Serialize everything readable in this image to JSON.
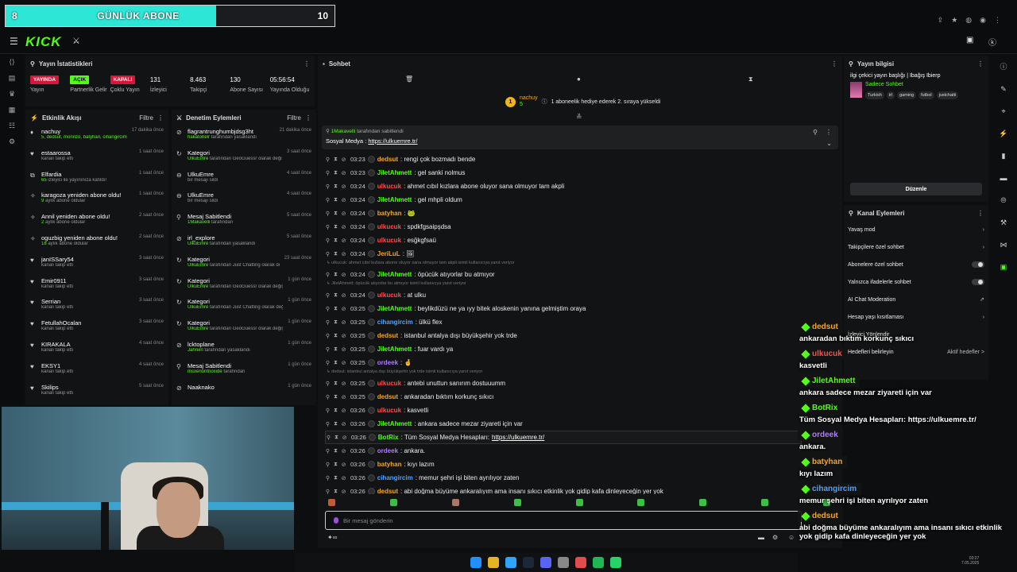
{
  "sub_goal": {
    "left": "8",
    "title": "GÜNLÜK ABONE",
    "right": "10",
    "progress": 0.8
  },
  "header": {
    "logo": "KICK",
    "logo_sup": "beta"
  },
  "stats": {
    "title": "Yayın İstatistikleri",
    "items": [
      {
        "value": "YAYINDA",
        "label": "Yayın",
        "badge": "red"
      },
      {
        "value": "AÇIK",
        "label": "Partnerlik Gelir",
        "badge": "green"
      },
      {
        "value": "KAPALI",
        "label": "Çoklu Yayın",
        "badge": "red"
      },
      {
        "value": "131",
        "label": "İzleyici"
      },
      {
        "value": "8.463",
        "label": "Takipçi"
      },
      {
        "value": "130",
        "label": "Abone Sayısı"
      },
      {
        "value": "05:56:54",
        "label": "Yayında Olduğu"
      }
    ]
  },
  "activity": {
    "title": "Etkinlik Akışı",
    "filter": "Filtre",
    "items": [
      {
        "icon": "♦",
        "name": "nachuy",
        "sub_g": "5, dedsut, monnzo, batyhan, cihangircim, JeriLuL",
        "sub": "isimli kullanıcıya abonelik hediye etti.",
        "time": "17 dakika önce"
      },
      {
        "icon": "♥",
        "name": "estaarossa",
        "sub": "kanalı takip etti",
        "time": "1 saat önce"
      },
      {
        "icon": "⧉",
        "name": "Elfardia",
        "sub_g": "65",
        "sub": "izleyici ile yayınınıza katıldı!",
        "time": "1 saat önce"
      },
      {
        "icon": "✧",
        "name": "karagoza yeniden abone oldu!",
        "sub_g": "9",
        "sub": "aylık abone oldular",
        "time": "1 saat önce"
      },
      {
        "icon": "✧",
        "name": "Annil yeniden abone oldu!",
        "sub_g": "2",
        "sub": "aylık abone oldular",
        "time": "2 saat önce"
      },
      {
        "icon": "✧",
        "name": "oguzbig yeniden abone oldu!",
        "sub_g": "18",
        "sub": "aylık abone oldular",
        "time": "2 saat önce"
      },
      {
        "icon": "♥",
        "name": "janISSary54",
        "sub": "kanalı takip etti",
        "time": "3 saat önce"
      },
      {
        "icon": "♥",
        "name": "Emir0911",
        "sub": "kanalı takip etti",
        "time": "3 saat önce"
      },
      {
        "icon": "♥",
        "name": "Serrian",
        "sub": "kanalı takip etti",
        "time": "3 saat önce"
      },
      {
        "icon": "♥",
        "name": "FetullahOcalan",
        "sub": "kanalı takip etti",
        "time": "3 saat önce"
      },
      {
        "icon": "♥",
        "name": "KIRAKALA",
        "sub": "kanalı takip etti",
        "time": "4 saat önce"
      },
      {
        "icon": "♥",
        "name": "EKSY1",
        "sub": "kanalı takip etti",
        "time": "4 saat önce"
      },
      {
        "icon": "♥",
        "name": "Skilips",
        "sub": "kanalı takip etti",
        "time": "5 saat önce"
      }
    ]
  },
  "moderation": {
    "title": "Denetim Eylemleri",
    "filter": "Filtre",
    "items": [
      {
        "icon": "⊘",
        "name": "flagrantrunghumbjdsg3ht",
        "sub_g": "hakatohelr",
        "sub": "tarafından yasaklandı",
        "time": "21 dakika önce"
      },
      {
        "icon": "↻",
        "name": "Kategori",
        "sub_g": "UlkuEmre",
        "sub": "tarafından GeoGuessr olarak değiştirildi",
        "time": "3 saat önce"
      },
      {
        "icon": "⊖",
        "name": "UlkuEmre",
        "sub": "bir mesajı sildi",
        "time": "4 saat önce"
      },
      {
        "icon": "⊖",
        "name": "UlkuEmre",
        "sub": "bir mesajı sildi",
        "time": "4 saat önce"
      },
      {
        "icon": "⚲",
        "name": "Mesaj Sabitlendi",
        "sub_g": "1Makavelli",
        "sub": "tarafından",
        "time": "5 saat önce"
      },
      {
        "icon": "⊘",
        "name": "irl_explore",
        "sub_g": "UlkuEmre",
        "sub": "tarafından yasaklandı",
        "time": "5 saat önce"
      },
      {
        "icon": "↻",
        "name": "Kategori",
        "sub_g": "UlkuEmre",
        "sub": "tarafından Just Chatting olarak değiştirildi",
        "time": "23 saat önce"
      },
      {
        "icon": "↻",
        "name": "Kategori",
        "sub_g": "UlkuEmre",
        "sub": "tarafından GeoGuessr olarak değiştirildi",
        "time": "1 gün önce"
      },
      {
        "icon": "↻",
        "name": "Kategori",
        "sub_g": "UlkuEmre",
        "sub": "tarafından Just Chatting olarak değiştirildi",
        "time": "1 gün önce"
      },
      {
        "icon": "↻",
        "name": "Kategori",
        "sub_g": "UlkuEmre",
        "sub": "tarafından GeoGuessr olarak değiştirildi",
        "time": "1 gün önce"
      },
      {
        "icon": "⊘",
        "name": "lcktoplane",
        "sub_g": "Jahrein",
        "sub": "tarafından yasaklandı",
        "time": "1 gün önce"
      },
      {
        "icon": "⚲",
        "name": "Mesaj Sabitlendi",
        "sub_g": "msxenontrioxide",
        "sub": "tarafından",
        "time": "1 gün önce"
      },
      {
        "icon": "⊘",
        "name": "Naaknako",
        "sub": "",
        "time": "1 gün önce"
      }
    ]
  },
  "chat": {
    "title": "Sohbet",
    "gift": {
      "name": "nachuy",
      "count": "5",
      "text": "1 aboneelik hediye ederek 2. sıraya yükseldi"
    },
    "pinned": {
      "by": "1Makavelli",
      "by_suffix": "tarafından sabitlendi",
      "label": "Sosyal Medya :",
      "link": "https://ulkuemre.tr/"
    },
    "messages": [
      {
        "time": "03:23",
        "user": "dedsut",
        "color": "#f5a623",
        "text": "rengi çok bozmadı bende"
      },
      {
        "time": "03:23",
        "user": "JiletAhmett",
        "color": "#53fc18",
        "text": "gel sanki nolmus"
      },
      {
        "time": "03:24",
        "user": "ulkucuk",
        "color": "#ff4d4d",
        "text": "ahmet cıbıl kızlara abone oluyor sana olmuyor tam akpli"
      },
      {
        "time": "03:24",
        "user": "JiletAhmett",
        "color": "#53fc18",
        "text": "gel mhpli oldum"
      },
      {
        "time": "03:24",
        "user": "batyhan",
        "color": "#f5a623",
        "text": "🐸"
      },
      {
        "time": "03:24",
        "user": "ulkucuk",
        "color": "#ff4d4d",
        "text": "spdkfgsaipşdsa"
      },
      {
        "time": "03:24",
        "user": "ulkucuk",
        "color": "#ff4d4d",
        "text": "esğkgfsaü"
      },
      {
        "time": "03:24",
        "user": "JeriLuL",
        "color": "#f5a623",
        "text": "🖼"
      },
      {
        "reply": "ulkucuk: ahmet cıbıl kızlara abone oluyor sana olmuyor tam akpli isimli kullanıcıya yanıt veriyor"
      },
      {
        "time": "03:24",
        "user": "JiletAhmett",
        "color": "#53fc18",
        "text": "öpücük atıyorlar bu atmıyor"
      },
      {
        "reply": "JiletAhmett: öpücük atıyorlar bu atmıyor isimli kullanıcıya yanıt veriyor"
      },
      {
        "time": "03:24",
        "user": "ulkucuk",
        "color": "#ff4d4d",
        "text": "at ulku"
      },
      {
        "time": "03:25",
        "user": "JiletAhmett",
        "color": "#53fc18",
        "text": "beylikdüzü ne ya ıyy bitek aloskenin yanına gelmiştim oraya"
      },
      {
        "time": "03:25",
        "user": "cihangircim",
        "color": "#4fa3ff",
        "text": "ülkü flex"
      },
      {
        "time": "03:25",
        "user": "dedsut",
        "color": "#f5a623",
        "text": "istanbul antalya dışı büyükşehir yok trde"
      },
      {
        "time": "03:25",
        "user": "JiletAhmett",
        "color": "#53fc18",
        "text": "fuar vardı ya"
      },
      {
        "time": "03:25",
        "user": "ordeek",
        "color": "#b07cff",
        "text": "🤞"
      },
      {
        "reply": "dedsut: istanbul antalya dışı büyükşehir yok trde isimli kullanıcıya yanıt veriyor"
      },
      {
        "time": "03:25",
        "user": "ulkucuk",
        "color": "#ff4d4d",
        "text": "antebi unuttun sanırım dostuuumm"
      },
      {
        "time": "03:25",
        "user": "dedsut",
        "color": "#f5a623",
        "text": "ankaradan bıktım korkunç sıkıcı"
      },
      {
        "time": "03:26",
        "user": "ulkucuk",
        "color": "#ff4d4d",
        "text": "kasvetli"
      },
      {
        "time": "03:26",
        "user": "JiletAhmett",
        "color": "#53fc18",
        "text": "ankara sadece mezar ziyareti için var"
      },
      {
        "time": "03:26",
        "user": "BotRix",
        "color": "#53fc18",
        "text": "Tüm Sosyal Medya Hesapları: ",
        "link": "https://ulkuemre.tr/",
        "highlight": true
      },
      {
        "time": "03:26",
        "user": "ordeek",
        "color": "#b07cff",
        "text": "ankara."
      },
      {
        "time": "03:26",
        "user": "batyhan",
        "color": "#f5a623",
        "text": "kıyı lazım"
      },
      {
        "time": "03:26",
        "user": "cihangircim",
        "color": "#4fa3ff",
        "text": "memur şehri işi biten ayrılıyor zaten"
      },
      {
        "time": "03:26",
        "user": "dedsut",
        "color": "#f5a623",
        "text": "abi doğma büyüme ankaralıyım ama insanı sıkıcı etkinlik yok gidip kafa dinleyeceğin yer yok"
      }
    ],
    "input_placeholder": "Bir mesaj gönderin"
  },
  "stream_info": {
    "title": "Yayın bilgisi",
    "stream_title": "ilgi çekici yayın başlığı | Ibağış Ibierp",
    "category": "Sadece Sohbet",
    "tags": [
      "Turkish",
      "irl",
      "gaming",
      "futbol",
      "justchatti"
    ],
    "edit_label": "Düzenle"
  },
  "channel_actions": {
    "title": "Kanal Eylemleri",
    "items": [
      {
        "label": "Yavaş mod",
        "ctrl": "arrow"
      },
      {
        "label": "Takipçilere özel sohbet",
        "ctrl": "arrow"
      },
      {
        "label": "Abonelere özel sohbet",
        "ctrl": "toggle"
      },
      {
        "label": "Yalnızca ifadelerle sohbet",
        "ctrl": "toggle"
      },
      {
        "label": "AI Chat Moderation",
        "ctrl": "ext"
      },
      {
        "label": "Hesap yaşı kısıtlaması",
        "ctrl": "arrow"
      },
      {
        "label": "İzleyici Yönlendir",
        "ctrl": ""
      },
      {
        "label": "Hedefleri belirleyin",
        "ctrl": "Aktif hedefler >"
      }
    ]
  },
  "overlay_chat": [
    {
      "user": "dedsut",
      "color": "#f5a623",
      "text": "ankaradan bıktım korkunç sıkıcı"
    },
    {
      "user": "ulkucuk",
      "color": "#ff4d4d",
      "text": "kasvetli"
    },
    {
      "user": "JiletAhmett",
      "color": "#53fc18",
      "text": "ankara sadece mezar ziyareti için var"
    },
    {
      "user": "BotRix",
      "color": "#53fc18",
      "text": "Tüm Sosyal Medya Hesapları: https://ulkuemre.tr/"
    },
    {
      "user": "ordeek",
      "color": "#b07cff",
      "text": "ankara."
    },
    {
      "user": "batyhan",
      "color": "#f5a623",
      "text": "kıyı lazım"
    },
    {
      "user": "cihangircim",
      "color": "#4fa3ff",
      "text": "memur şehri işi biten ayrılıyor zaten"
    },
    {
      "user": "dedsut",
      "color": "#f5a623",
      "text": "abi doğma büyüme ankaralıyım ama insanı sıkıcı etkinlik yok gidip kafa dinleyeceğin yer yok"
    }
  ],
  "taskbar": [
    "#1e90ff",
    "#e6b422",
    "#2fa4ff",
    "#1b2838",
    "#5865f2",
    "#888888",
    "#e14c4c",
    "#1db954",
    "#25d366"
  ],
  "clock": {
    "time": "03:27",
    "date": "7.05.2025"
  }
}
